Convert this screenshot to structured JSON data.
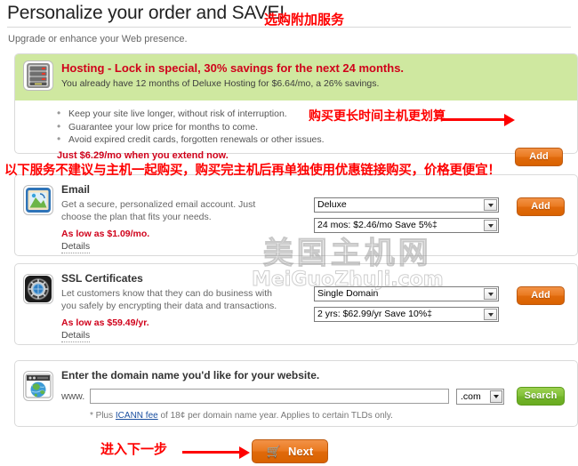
{
  "header": {
    "title": "Personalize your order and SAVE!",
    "subtitle": "Upgrade or enhance your Web presence."
  },
  "hosting": {
    "icon": "server-rack-icon",
    "headline": "Hosting - Lock in special, 30% savings for the next 24 months.",
    "subline": "You already have 12 months of Deluxe Hosting for $6.64/mo, a 26% savings.",
    "benefits": [
      "Keep your site live longer, without risk of interruption.",
      "Guarantee your low price for months to come.",
      "Avoid expired credit cards, forgotten renewals or other issues."
    ],
    "price_line": "Just $6.29/mo when you extend now.",
    "add_label": "Add"
  },
  "email": {
    "icon": "email-photo-icon",
    "title": "Email",
    "description": "Get a secure, personalized email account. Just choose the plan that fits your needs.",
    "low_price": "As low as $1.09/mo.",
    "details_label": "Details",
    "plan_select": "Deluxe",
    "term_select": "24 mos: $2.46/mo Save 5%‡",
    "add_label": "Add"
  },
  "ssl": {
    "icon": "vault-dial-icon",
    "title": "SSL Certificates",
    "description": "Let customers know that they can do business with you safely by encrypting their data and transactions.",
    "low_price": "As low as $59.49/yr.",
    "details_label": "Details",
    "type_select": "Single Domain",
    "term_select": "2 yrs: $62.99/yr Save 10%‡",
    "add_label": "Add"
  },
  "domain": {
    "icon": "browser-globe-icon",
    "title": "Enter the domain name you'd like for your website.",
    "www_prefix": "www.",
    "input_value": "",
    "input_placeholder": "",
    "tld_select": ".com",
    "search_label": "Search",
    "footnote_pre": "* Plus ",
    "footnote_link": "ICANN fee",
    "footnote_post": " of 18¢ per domain name year. Applies to certain TLDs only."
  },
  "footer": {
    "next_label": "Next",
    "cart_icon": "shopping-cart-icon"
  },
  "annotations": {
    "title_note": "选购附加服务",
    "hosting_note": "购买更长时间主机更划算",
    "warning_bar": "以下服务不建议与主机一起购买，购买完主机后再单独使用优惠链接购买，价格更便宜！",
    "next_note": "进入下一步",
    "color": "#fe0000"
  },
  "watermark": {
    "cn": "美国主机网",
    "en": "MeiGuoZhuJi.com"
  },
  "colors": {
    "promo_green": "#cfe8a0",
    "red_text": "#d0021b",
    "orange_button": "#e8780f",
    "green_button": "#7cbd2f"
  }
}
